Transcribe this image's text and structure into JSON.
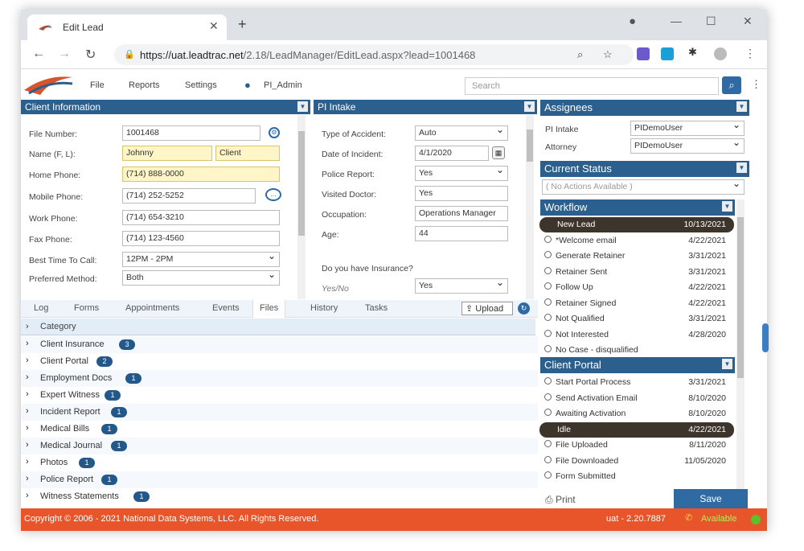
{
  "browser": {
    "tab_title": "Edit Lead",
    "url_host": "https://uat.leadtrac.net",
    "url_path": "/2.18/LeadManager/EditLead.aspx?lead=1001468"
  },
  "app": {
    "menu": [
      "File",
      "Reports",
      "Settings"
    ],
    "user": "PI_Admin",
    "search_placeholder": "Search"
  },
  "client_info": {
    "title": "Client Information",
    "fields": [
      {
        "label": "File Number:",
        "value": "1001468"
      },
      {
        "label": "Name (F, L):",
        "value": "Johnny",
        "value2": "Client"
      },
      {
        "label": "Home Phone:",
        "value": "(714) 888-0000"
      },
      {
        "label": "Mobile Phone:",
        "value": "(714) 252-5252"
      },
      {
        "label": "Work Phone:",
        "value": "(714) 654-3210"
      },
      {
        "label": "Fax Phone:",
        "value": "(714) 123-4560"
      },
      {
        "label": "Best Time To Call:",
        "value": "12PM - 2PM"
      },
      {
        "label": "Preferred Method:",
        "value": "Both"
      }
    ]
  },
  "pi_intake": {
    "title": "PI Intake",
    "fields": [
      {
        "label": "Type of Accident:",
        "value": "Auto"
      },
      {
        "label": "Date of Incident:",
        "value": "4/1/2020"
      },
      {
        "label": "Police Report:",
        "value": "Yes"
      },
      {
        "label": "Visited Doctor:",
        "value": "Yes"
      },
      {
        "label": "Occupation:",
        "value": "Operations Manager"
      },
      {
        "label": "Age:",
        "value": "44"
      }
    ],
    "question": "Do you have Insurance?",
    "q_label": "Yes/No",
    "q_value": "Yes"
  },
  "subtabs": [
    "Log",
    "Forms",
    "Appointments",
    "Events",
    "Files",
    "History",
    "Tasks"
  ],
  "upload_label": "Upload",
  "files": {
    "header": "Category",
    "rows": [
      {
        "name": "Client Insurance",
        "count": "3"
      },
      {
        "name": "Client Portal",
        "count": "2"
      },
      {
        "name": "Employment Docs",
        "count": "1"
      },
      {
        "name": "Expert Witness",
        "count": "1"
      },
      {
        "name": "Incident Report",
        "count": "1"
      },
      {
        "name": "Medical Bills",
        "count": "1"
      },
      {
        "name": "Medical Journal",
        "count": "1"
      },
      {
        "name": "Photos",
        "count": "1"
      },
      {
        "name": "Police Report",
        "count": "1"
      },
      {
        "name": "Witness Statements",
        "count": "1"
      }
    ]
  },
  "assignees": {
    "title": "Assignees",
    "rows": [
      {
        "label": "PI Intake",
        "value": "PIDemoUser"
      },
      {
        "label": "Attorney",
        "value": "PIDemoUser"
      }
    ]
  },
  "current_status": {
    "title": "Current Status",
    "value": "( No Actions Available )"
  },
  "workflow": {
    "title": "Workflow",
    "items": [
      {
        "name": "New Lead",
        "date": "10/13/2021"
      },
      {
        "name": "*Welcome email",
        "date": "4/22/2021"
      },
      {
        "name": "Generate Retainer",
        "date": "3/31/2021"
      },
      {
        "name": "Retainer Sent",
        "date": "3/31/2021"
      },
      {
        "name": "Follow Up",
        "date": "4/22/2021"
      },
      {
        "name": "Retainer Signed",
        "date": "4/22/2021"
      },
      {
        "name": "Not Qualified",
        "date": "3/31/2021"
      },
      {
        "name": "Not Interested",
        "date": "4/28/2020"
      },
      {
        "name": "No Case - disqualified",
        "date": ""
      }
    ]
  },
  "client_portal": {
    "title": "Client Portal",
    "items": [
      {
        "name": "Start Portal Process",
        "date": "3/31/2021"
      },
      {
        "name": "Send Activation Email",
        "date": "8/10/2020"
      },
      {
        "name": "Awaiting Activation",
        "date": "8/10/2020"
      },
      {
        "name": "Idle",
        "date": "4/22/2021"
      },
      {
        "name": "File Uploaded",
        "date": "8/11/2020"
      },
      {
        "name": "File Downloaded",
        "date": "11/05/2020"
      },
      {
        "name": "Form Submitted",
        "date": ""
      }
    ]
  },
  "actions": {
    "print": "Print",
    "save": "Save"
  },
  "footer": {
    "copyright": "Copyright © 2006 - 2021 National Data Systems, LLC. All Rights Reserved.",
    "version": "uat - 2.20.7887",
    "status": "Available"
  },
  "colors": {
    "header_blue": "#2a5f8e",
    "footer_orange": "#e8552a",
    "active_row": "#3d352c"
  }
}
